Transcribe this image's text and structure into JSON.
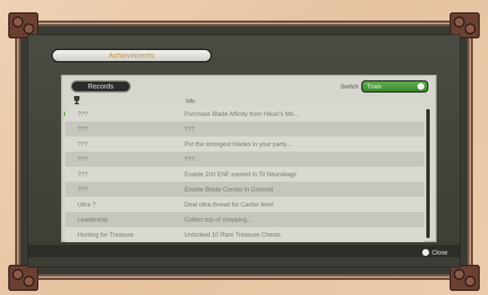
{
  "window": {
    "title": "Achievements"
  },
  "panel": {
    "tab_label": "Records",
    "switch_label": "Switch",
    "toggle_value": "Trials"
  },
  "columns": {
    "col2_header": "Info"
  },
  "rows": [
    {
      "name": "???",
      "desc": "Purchase Blade Affinity from Hikari's Mo..."
    },
    {
      "name": "???",
      "desc": "???"
    },
    {
      "name": "???",
      "desc": "Put the strongest blades in your party..."
    },
    {
      "name": "???",
      "desc": "???"
    },
    {
      "name": "???",
      "desc": "Enable 200 ENF earned in Til Neuraliago"
    },
    {
      "name": "???",
      "desc": "Enable Blade Combo in Gormott"
    },
    {
      "name": "Ultra ?",
      "desc": "Deal ultra thread for Cartier level"
    },
    {
      "name": "Leadership",
      "desc": "Collect top of chopping..."
    },
    {
      "name": "Hunting for Treasure",
      "desc": "Unlocked 10 Rare Treasure Chests"
    }
  ],
  "footer": {
    "close_label": "Close"
  },
  "colors": {
    "accent_green": "#4aa730",
    "title_text": "#c0882c",
    "frame_brown": "#6b4a3a"
  }
}
